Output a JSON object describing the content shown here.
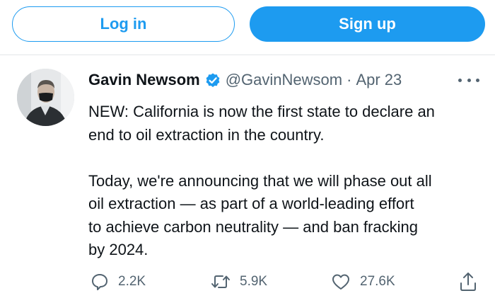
{
  "auth": {
    "login_label": "Log in",
    "signup_label": "Sign up"
  },
  "tweet": {
    "author_name": "Gavin Newsom",
    "verified": true,
    "handle": "@GavinNewsom",
    "separator": "·",
    "date": "Apr 23",
    "paragraphs": [
      "NEW: California is now the first state to declare an\nend to oil extraction in the country.",
      "Today, we're announcing that we will phase out all\noil extraction — as part of a world-leading effort\nto achieve carbon neutrality — and ban fracking\nby 2024."
    ],
    "replies": "2.2K",
    "retweets": "5.9K",
    "likes": "27.6K"
  },
  "icons": {
    "avatar": "profile-photo",
    "verified": "verified-badge-icon",
    "more": "more-options-icon",
    "reply": "reply-icon",
    "retweet": "retweet-icon",
    "like": "heart-icon",
    "share": "share-icon"
  },
  "colors": {
    "brand_blue": "#1d9bf0",
    "secondary_text": "#536471",
    "primary_text": "#0f1419"
  }
}
